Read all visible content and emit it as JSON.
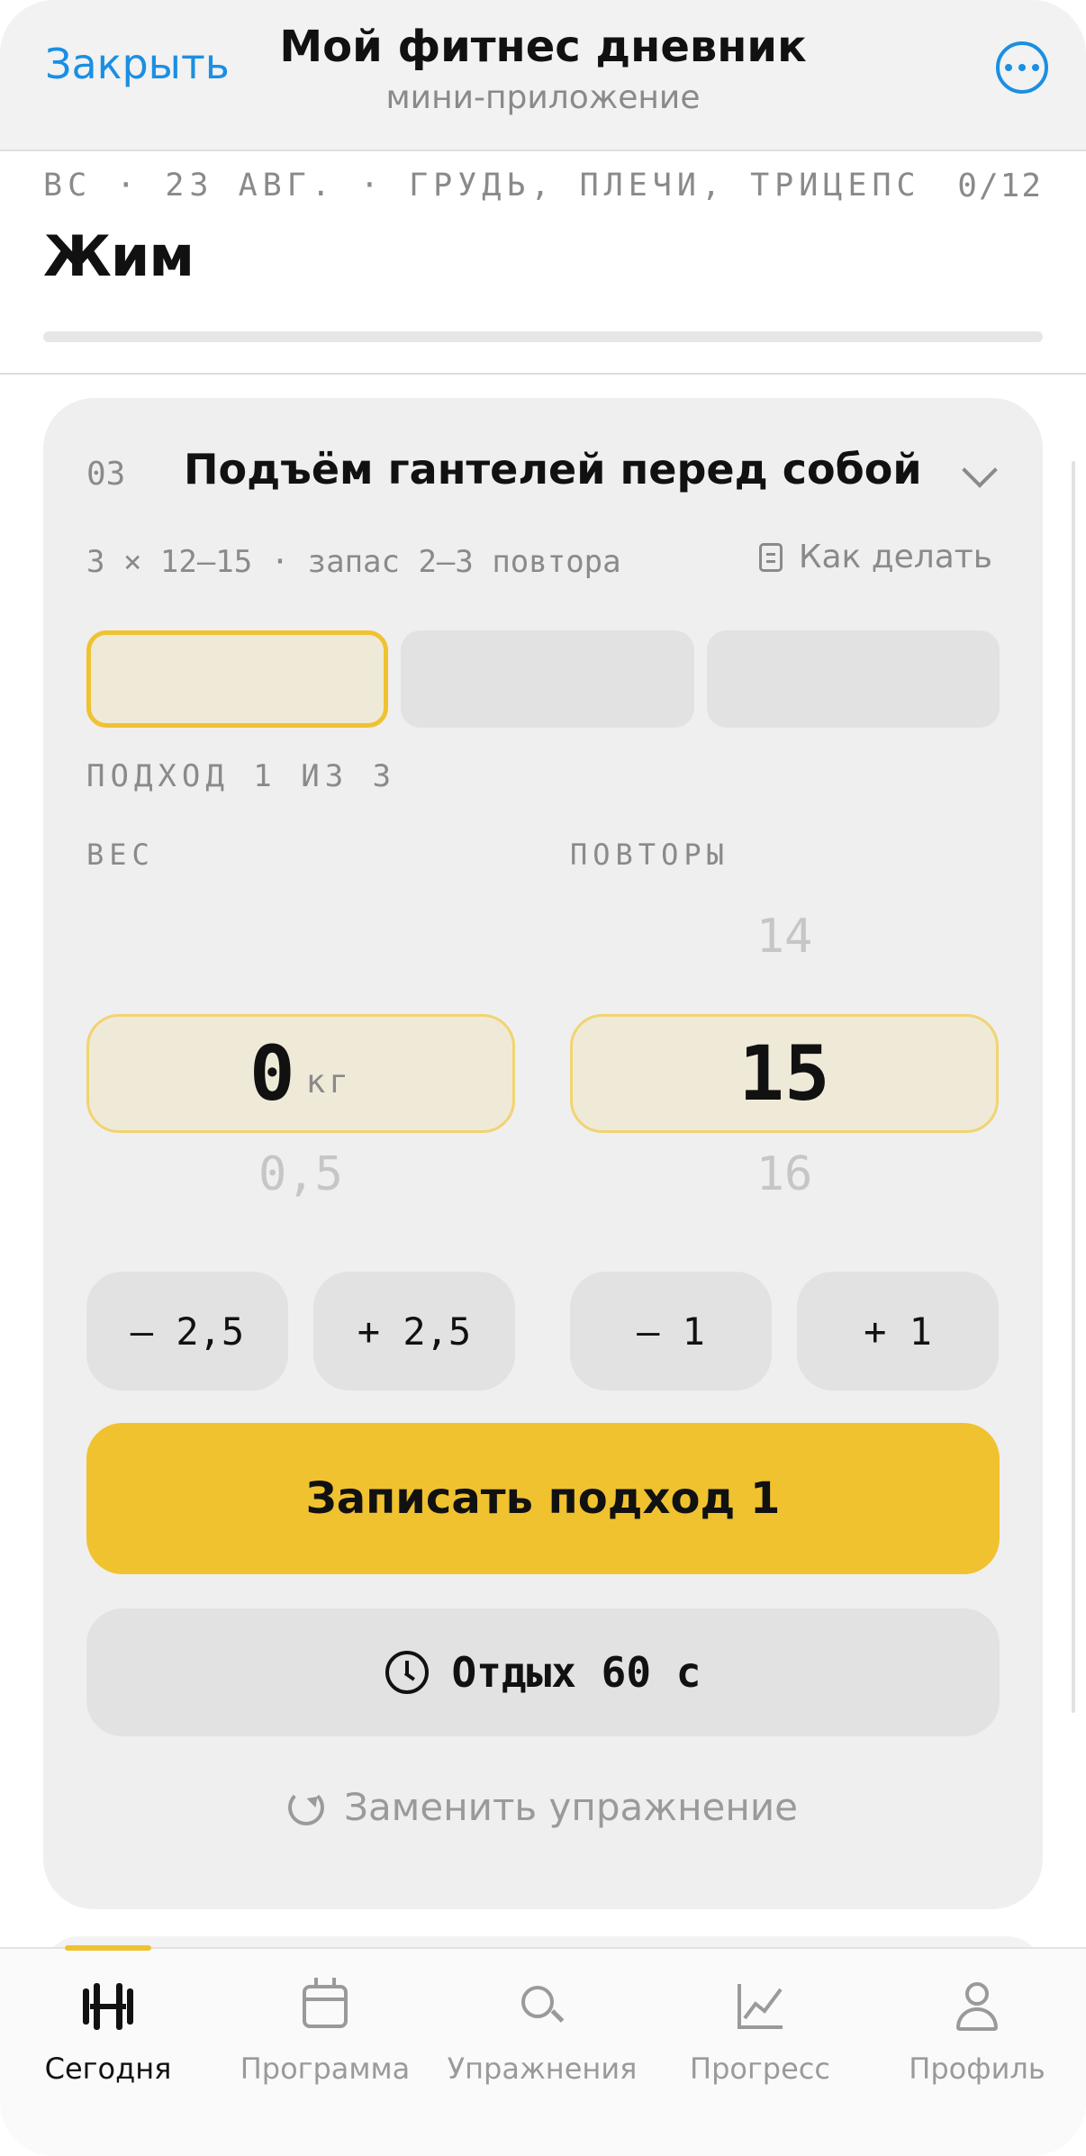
{
  "header": {
    "close_label": "Закрыть",
    "title": "Мой фитнес дневник",
    "subtitle": "мини-приложение",
    "more_icon": "ellipsis-circle-icon"
  },
  "day": {
    "line": "ВС · 23 АВГ. · ГРУДЬ, ПЛЕЧИ, ТРИЦЕПС",
    "count": "0/12",
    "title": "Жим",
    "progress_fraction": 0
  },
  "exercise": {
    "number": "03",
    "title": "Подъём гантелей перед собой",
    "meta": "3 × 12–15 · запас 2–3 повтора",
    "howto_label": "Как делать",
    "sets_total": 3,
    "active_set_index": 0,
    "set_label": "ПОДХОД 1 ИЗ 3",
    "weight": {
      "label": "ВЕС",
      "value": "0",
      "unit": "кг",
      "next": "0,5",
      "minus": "– 2,5",
      "plus": "+ 2,5"
    },
    "reps": {
      "label": "ПОВТОРЫ",
      "prev": "14",
      "value": "15",
      "next": "16",
      "minus": "– 1",
      "plus": "+ 1"
    },
    "log_button": "Записать подход 1",
    "rest_button": "Отдых 60 с",
    "replace_label": "Заменить упражнение"
  },
  "tabs": [
    {
      "label": "Сегодня",
      "icon": "dumbbell-icon",
      "active": true
    },
    {
      "label": "Программа",
      "icon": "calendar-icon",
      "active": false
    },
    {
      "label": "Упражнения",
      "icon": "search-icon",
      "active": false
    },
    {
      "label": "Прогресс",
      "icon": "chart-icon",
      "active": false
    },
    {
      "label": "Профиль",
      "icon": "person-icon",
      "active": false
    }
  ],
  "colors": {
    "accent": "#f0c230",
    "link": "#1a8fe3",
    "active_field_bg": "#efead7"
  }
}
